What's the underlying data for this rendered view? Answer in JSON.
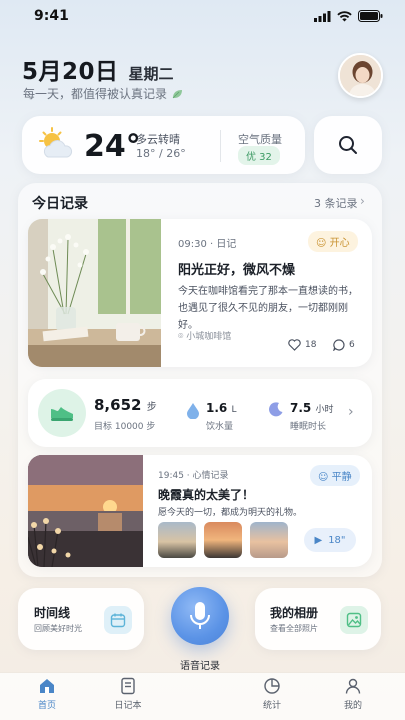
{
  "status": {
    "time": "9:41"
  },
  "header": {
    "date": "5月20日",
    "weekday": "星期二",
    "subtitle": "每一天，都值得被认真记录"
  },
  "weather": {
    "temperature": "24°",
    "condition": "多云转晴",
    "range": "18° / 26°",
    "aq_label": "空气质量",
    "aq_value": "优 32"
  },
  "today": {
    "title": "今日记录",
    "count": "3 条记录",
    "entry1": {
      "meta": "09:30 · 日记",
      "mood": "开心",
      "title": "阳光正好，微风不燥",
      "body_line1": "今天在咖啡馆看完了那本一直想读的书，",
      "body_line2": "也遇见了很久不见的朋友，一切都刚刚好。",
      "location": "小城咖啡馆",
      "likes": "18",
      "comments": "6"
    },
    "health": {
      "steps": "8,652",
      "steps_unit": "步",
      "goal": "目标 10000 步",
      "water_value": "1.6",
      "water_unit": "L",
      "water_label": "饮水量",
      "sleep_value": "7.5",
      "sleep_unit": "小时",
      "sleep_label": "睡眠时长"
    },
    "entry2": {
      "meta": "19:45 · 心情记录",
      "mood": "平静",
      "title": "晚霞真的太美了！",
      "body": "愿今天的一切，都成为明天的礼物。",
      "voice_length": "18\""
    }
  },
  "actions": {
    "timeline_title": "时间线",
    "timeline_sub": "回顾美好时光",
    "voice_label": "语音记录",
    "album_title": "我的相册",
    "album_sub": "查看全部照片"
  },
  "tabs": [
    {
      "label": "首页",
      "icon": "home-icon"
    },
    {
      "label": "日记本",
      "icon": "notebook-icon"
    },
    {
      "label": "统计",
      "icon": "pie-chart-icon"
    },
    {
      "label": "我的",
      "icon": "user-icon"
    }
  ],
  "colors": {
    "accent": "#4a86c7",
    "green": "#3d9a64",
    "mood_happy": "#c99333"
  }
}
